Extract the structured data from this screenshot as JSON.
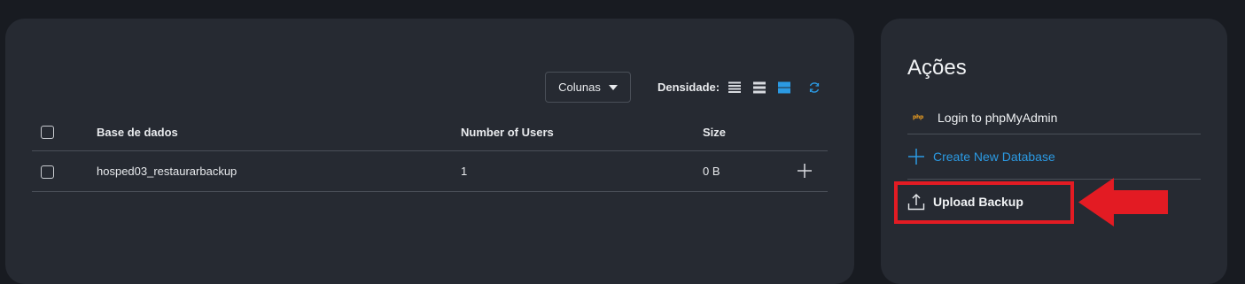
{
  "toolbar": {
    "columns_label": "Colunas",
    "density_label": "Densidade:"
  },
  "table": {
    "headers": {
      "database": "Base de dados",
      "users": "Number of Users",
      "size": "Size"
    },
    "rows": [
      {
        "database": "hosped03_restaurarbackup",
        "users": "1",
        "size": "0 B"
      }
    ]
  },
  "actions": {
    "title": "Ações",
    "login_label": "Login to phpMyAdmin",
    "create_label": "Create New Database",
    "upload_label": "Upload Backup"
  },
  "icons": {
    "columns_caret": "caret-down-icon",
    "density_compact": "density-compact-icon",
    "density_standard": "density-standard-icon",
    "density_comfortable": "density-comfortable-icon",
    "refresh": "refresh-icon",
    "expand_row": "plus-icon",
    "login": "phpmyadmin-logo",
    "create": "plus-icon",
    "upload": "upload-icon",
    "pointer_arrow": "arrow-left-icon"
  },
  "colors": {
    "page_bg": "#181b21",
    "panel_bg": "#262a32",
    "accent_blue": "#2b9ae3",
    "highlight_red": "#e31b23",
    "divider": "#4a4f58"
  }
}
